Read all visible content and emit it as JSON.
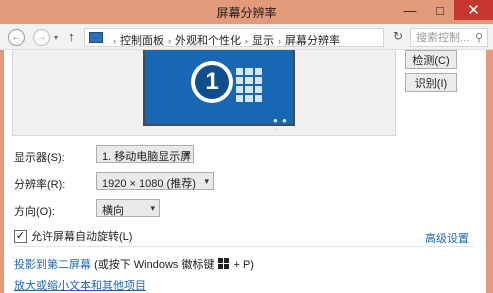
{
  "window": {
    "title": "屏幕分辨率",
    "controls": {
      "minimize": "—",
      "maximize": "□",
      "close": "✕"
    }
  },
  "address": {
    "back_icon": "←",
    "forward_icon": "→",
    "up_icon": "↑",
    "breadcrumbs": [
      "控制面板",
      "外观和个性化",
      "显示",
      "屏幕分辨率"
    ],
    "crumb_separator": "›",
    "dropdown_icon": "▾",
    "refresh_icon": "↻",
    "search_placeholder": "搜索控制...",
    "search_icon": "⚲"
  },
  "preview": {
    "monitor_number": "1",
    "dots": "● ● ●",
    "detect_button": "检测(C)",
    "identify_button": "识别(I)",
    "colors": {
      "monitor_fill": "#1767b2",
      "badge": "#104f8c"
    }
  },
  "settings": {
    "display_label": "显示器(S):",
    "display_value": "1. 移动电脑显示屏",
    "resolution_label": "分辨率(R):",
    "resolution_value": "1920 × 1080 (推荐)",
    "orientation_label": "方向(O):",
    "orientation_value": "横向",
    "select_arrow": "▾"
  },
  "rotation": {
    "checked": true,
    "check_mark": "✓",
    "label": "允许屏幕自动旋转(L)",
    "advanced_link": "高级设置"
  },
  "links": {
    "project_link": "投影到第二屏幕",
    "project_hint_pre": "(或按下 Windows 徽标键",
    "project_hint_post": "+ P)",
    "text_size_link": "放大或缩小文本和其他项目"
  },
  "colors": {
    "title_bar": "#e29a7b",
    "close_button": "#c7372f",
    "link": "#1f66b4"
  }
}
